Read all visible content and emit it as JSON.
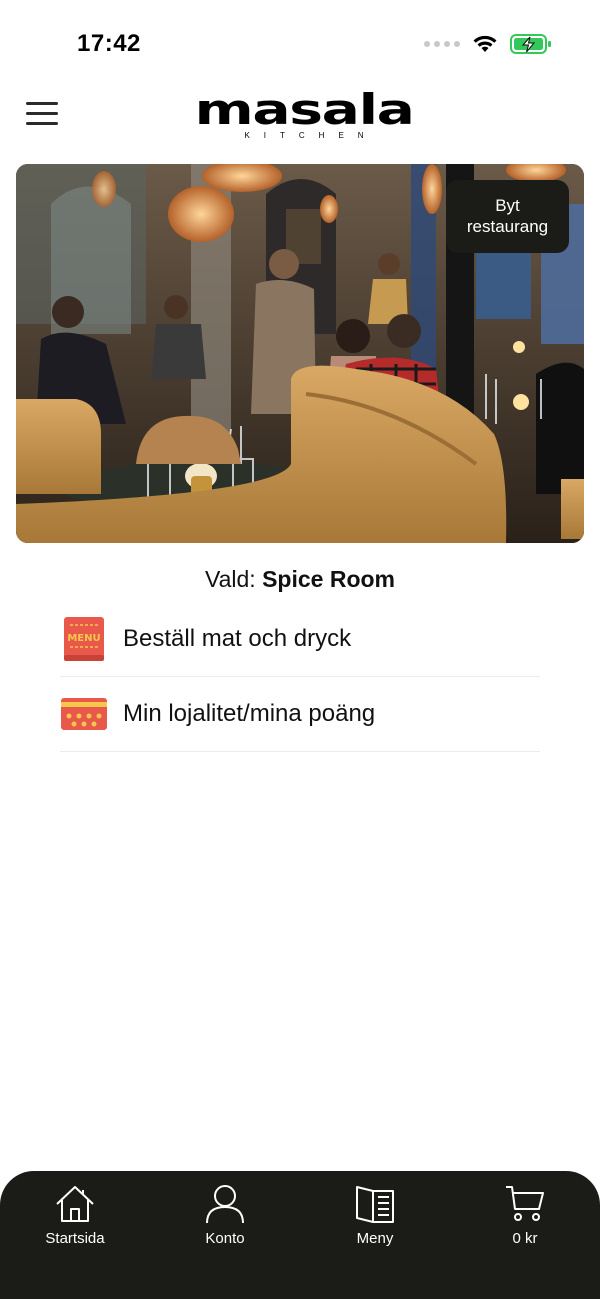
{
  "status_bar": {
    "time": "17:42"
  },
  "header": {
    "logo_main": "masala",
    "logo_sub": "KITCHEN"
  },
  "hero": {
    "switch_button_line1": "Byt",
    "switch_button_line2": "restaurang"
  },
  "selection": {
    "prefix": "Vald:",
    "name": "Spice Room"
  },
  "menu": {
    "items": [
      {
        "label": "Beställ mat och dryck",
        "icon": "menu-book-icon",
        "icon_text": "MENU"
      },
      {
        "label": "Min lojalitet/mina poäng",
        "icon": "loyalty-card-icon"
      }
    ]
  },
  "tab_bar": {
    "tabs": [
      {
        "label": "Startsida",
        "icon": "home-icon"
      },
      {
        "label": "Konto",
        "icon": "user-icon"
      },
      {
        "label": "Meny",
        "icon": "menu-book-icon"
      },
      {
        "label": "0 kr",
        "icon": "cart-icon"
      }
    ]
  },
  "colors": {
    "tab_bar_bg": "#1b1b18",
    "menu_icon_red": "#e8584b",
    "menu_icon_yellow": "#f5c84c",
    "battery_green": "#34c759"
  }
}
